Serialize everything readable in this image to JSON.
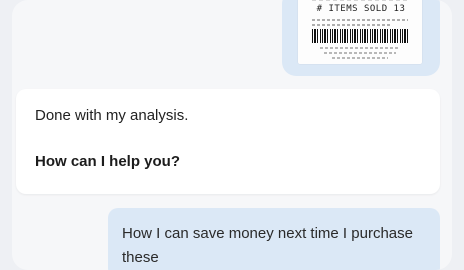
{
  "conversation": {
    "user_image": {
      "receipt_items_sold_text": "# ITEMS SOLD 13"
    },
    "assistant_message": {
      "line1": "Done with my analysis.",
      "line2": "How can I help you?"
    },
    "user_message": {
      "text": "How I can save money next time I purchase these"
    }
  },
  "colors": {
    "background": "#eef0f4",
    "user_bubble": "#dbe8f6",
    "assistant_bubble": "#ffffff"
  }
}
